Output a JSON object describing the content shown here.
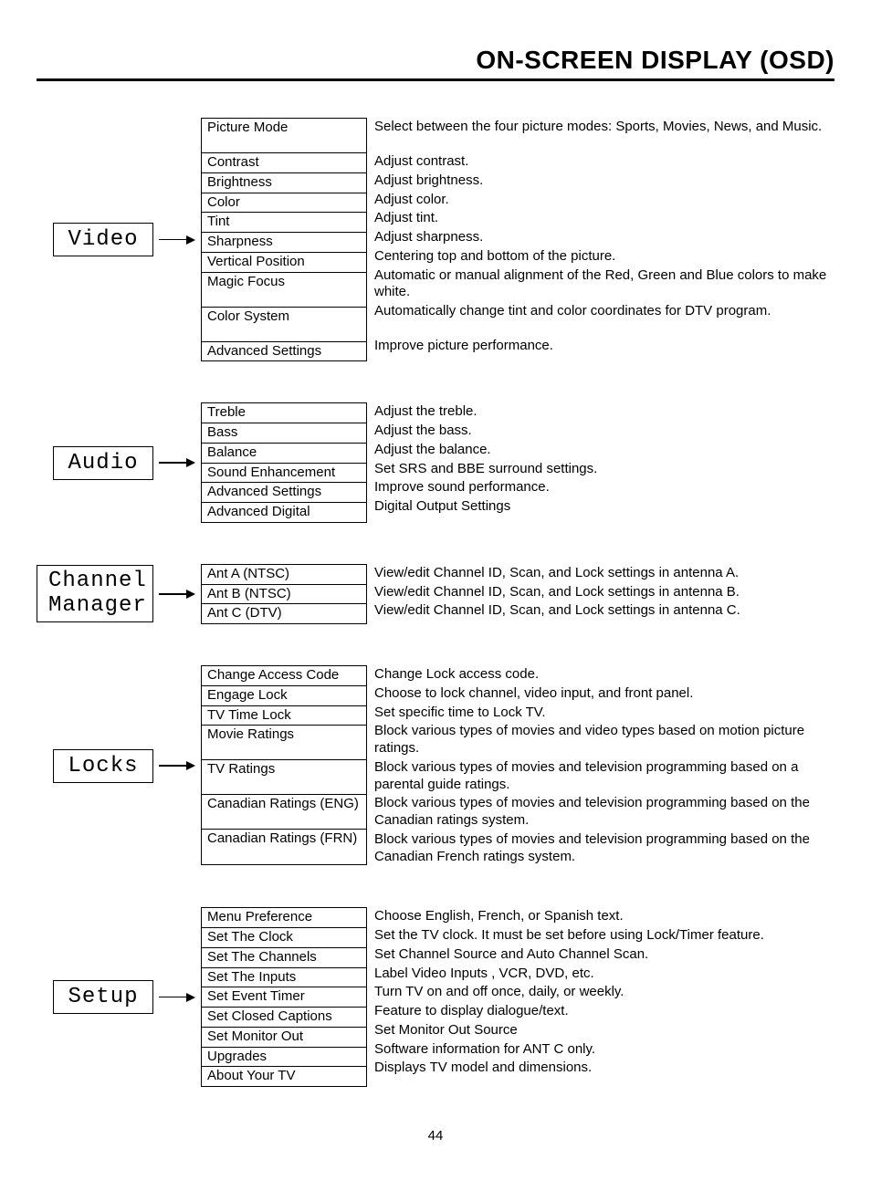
{
  "title": "ON-SCREEN DISPLAY (OSD)",
  "page_number": "44",
  "sections": [
    {
      "category": "Video",
      "items": [
        {
          "menu": "Picture Mode",
          "desc": "Select between the four picture modes: Sports, Movies, News, and Music.",
          "rows": 2
        },
        {
          "menu": "Contrast",
          "desc": "Adjust contrast.",
          "rows": 1
        },
        {
          "menu": "Brightness",
          "desc": "Adjust brightness.",
          "rows": 1
        },
        {
          "menu": "Color",
          "desc": "Adjust color.",
          "rows": 1
        },
        {
          "menu": "Tint",
          "desc": "Adjust tint.",
          "rows": 1
        },
        {
          "menu": "Sharpness",
          "desc": "Adjust sharpness.",
          "rows": 1
        },
        {
          "menu": "Vertical Position",
          "desc": "Centering top and bottom of the picture.",
          "rows": 1
        },
        {
          "menu": "Magic Focus",
          "desc": "Automatic or manual alignment of the Red, Green and Blue colors to make white.",
          "rows": 2
        },
        {
          "menu": "Color System",
          "desc": "Automatically change tint and color coordinates for DTV program.",
          "rows": 2
        },
        {
          "menu": "Advanced Settings",
          "desc": "Improve picture performance.",
          "rows": 1
        }
      ]
    },
    {
      "category": "Audio",
      "items": [
        {
          "menu": "Treble",
          "desc": "Adjust the treble.",
          "rows": 1
        },
        {
          "menu": "Bass",
          "desc": "Adjust the bass.",
          "rows": 1
        },
        {
          "menu": "Balance",
          "desc": "Adjust the balance.",
          "rows": 1
        },
        {
          "menu": "Sound Enhancement",
          "desc": "Set SRS and BBE surround settings.",
          "rows": 1
        },
        {
          "menu": "Advanced Settings",
          "desc": "Improve sound performance.",
          "rows": 1
        },
        {
          "menu": "Advanced Digital",
          "desc": "Digital Output Settings",
          "rows": 1
        }
      ]
    },
    {
      "category": "Channel Manager",
      "items": [
        {
          "menu": "Ant A (NTSC)",
          "desc": "View/edit Channel ID, Scan, and Lock settings in antenna A.",
          "rows": 1
        },
        {
          "menu": "Ant B (NTSC)",
          "desc": "View/edit Channel ID, Scan, and Lock settings in antenna B.",
          "rows": 1
        },
        {
          "menu": "Ant C (DTV)",
          "desc": "View/edit Channel ID, Scan, and Lock settings in antenna C.",
          "rows": 1
        }
      ]
    },
    {
      "category": "Locks",
      "items": [
        {
          "menu": "Change Access Code",
          "desc": "Change Lock access code.",
          "rows": 1
        },
        {
          "menu": "Engage Lock",
          "desc": "Choose to lock channel, video input, and front panel.",
          "rows": 1
        },
        {
          "menu": "TV Time Lock",
          "desc": "Set specific time to Lock TV.",
          "rows": 1
        },
        {
          "menu": "Movie Ratings",
          "desc": "Block various types of movies and video types based on motion picture ratings.",
          "rows": 2
        },
        {
          "menu": "TV Ratings",
          "desc": "Block various types of movies and television programming based on a parental guide ratings.",
          "rows": 2
        },
        {
          "menu": "Canadian Ratings (ENG)",
          "desc": "Block various types of movies and television programming based on the Canadian ratings system.",
          "rows": 2
        },
        {
          "menu": "Canadian Ratings (FRN)",
          "desc": "Block various types of movies and television programming based on the Canadian French ratings system.",
          "rows": 2
        }
      ]
    },
    {
      "category": "Setup",
      "items": [
        {
          "menu": "Menu Preference",
          "desc": "Choose English, French, or Spanish text.",
          "rows": 1
        },
        {
          "menu": "Set The Clock",
          "desc": "Set the TV clock.  It must be set before using Lock/Timer feature.",
          "rows": 1
        },
        {
          "menu": "Set The Channels",
          "desc": "Set Channel Source and Auto Channel Scan.",
          "rows": 1
        },
        {
          "menu": "Set The Inputs",
          "desc": "Label Video Inputs , VCR, DVD, etc.",
          "rows": 1
        },
        {
          "menu": "Set Event Timer",
          "desc": "Turn TV on and off once, daily, or weekly.",
          "rows": 1
        },
        {
          "menu": "Set Closed Captions",
          "desc": "Feature to display dialogue/text.",
          "rows": 1
        },
        {
          "menu": "Set Monitor Out",
          "desc": "Set Monitor Out Source",
          "rows": 1
        },
        {
          "menu": "Upgrades",
          "desc": "Software information for ANT C only.",
          "rows": 1
        },
        {
          "menu": "About Your TV",
          "desc": "Displays TV model and dimensions.",
          "rows": 1
        }
      ]
    }
  ]
}
